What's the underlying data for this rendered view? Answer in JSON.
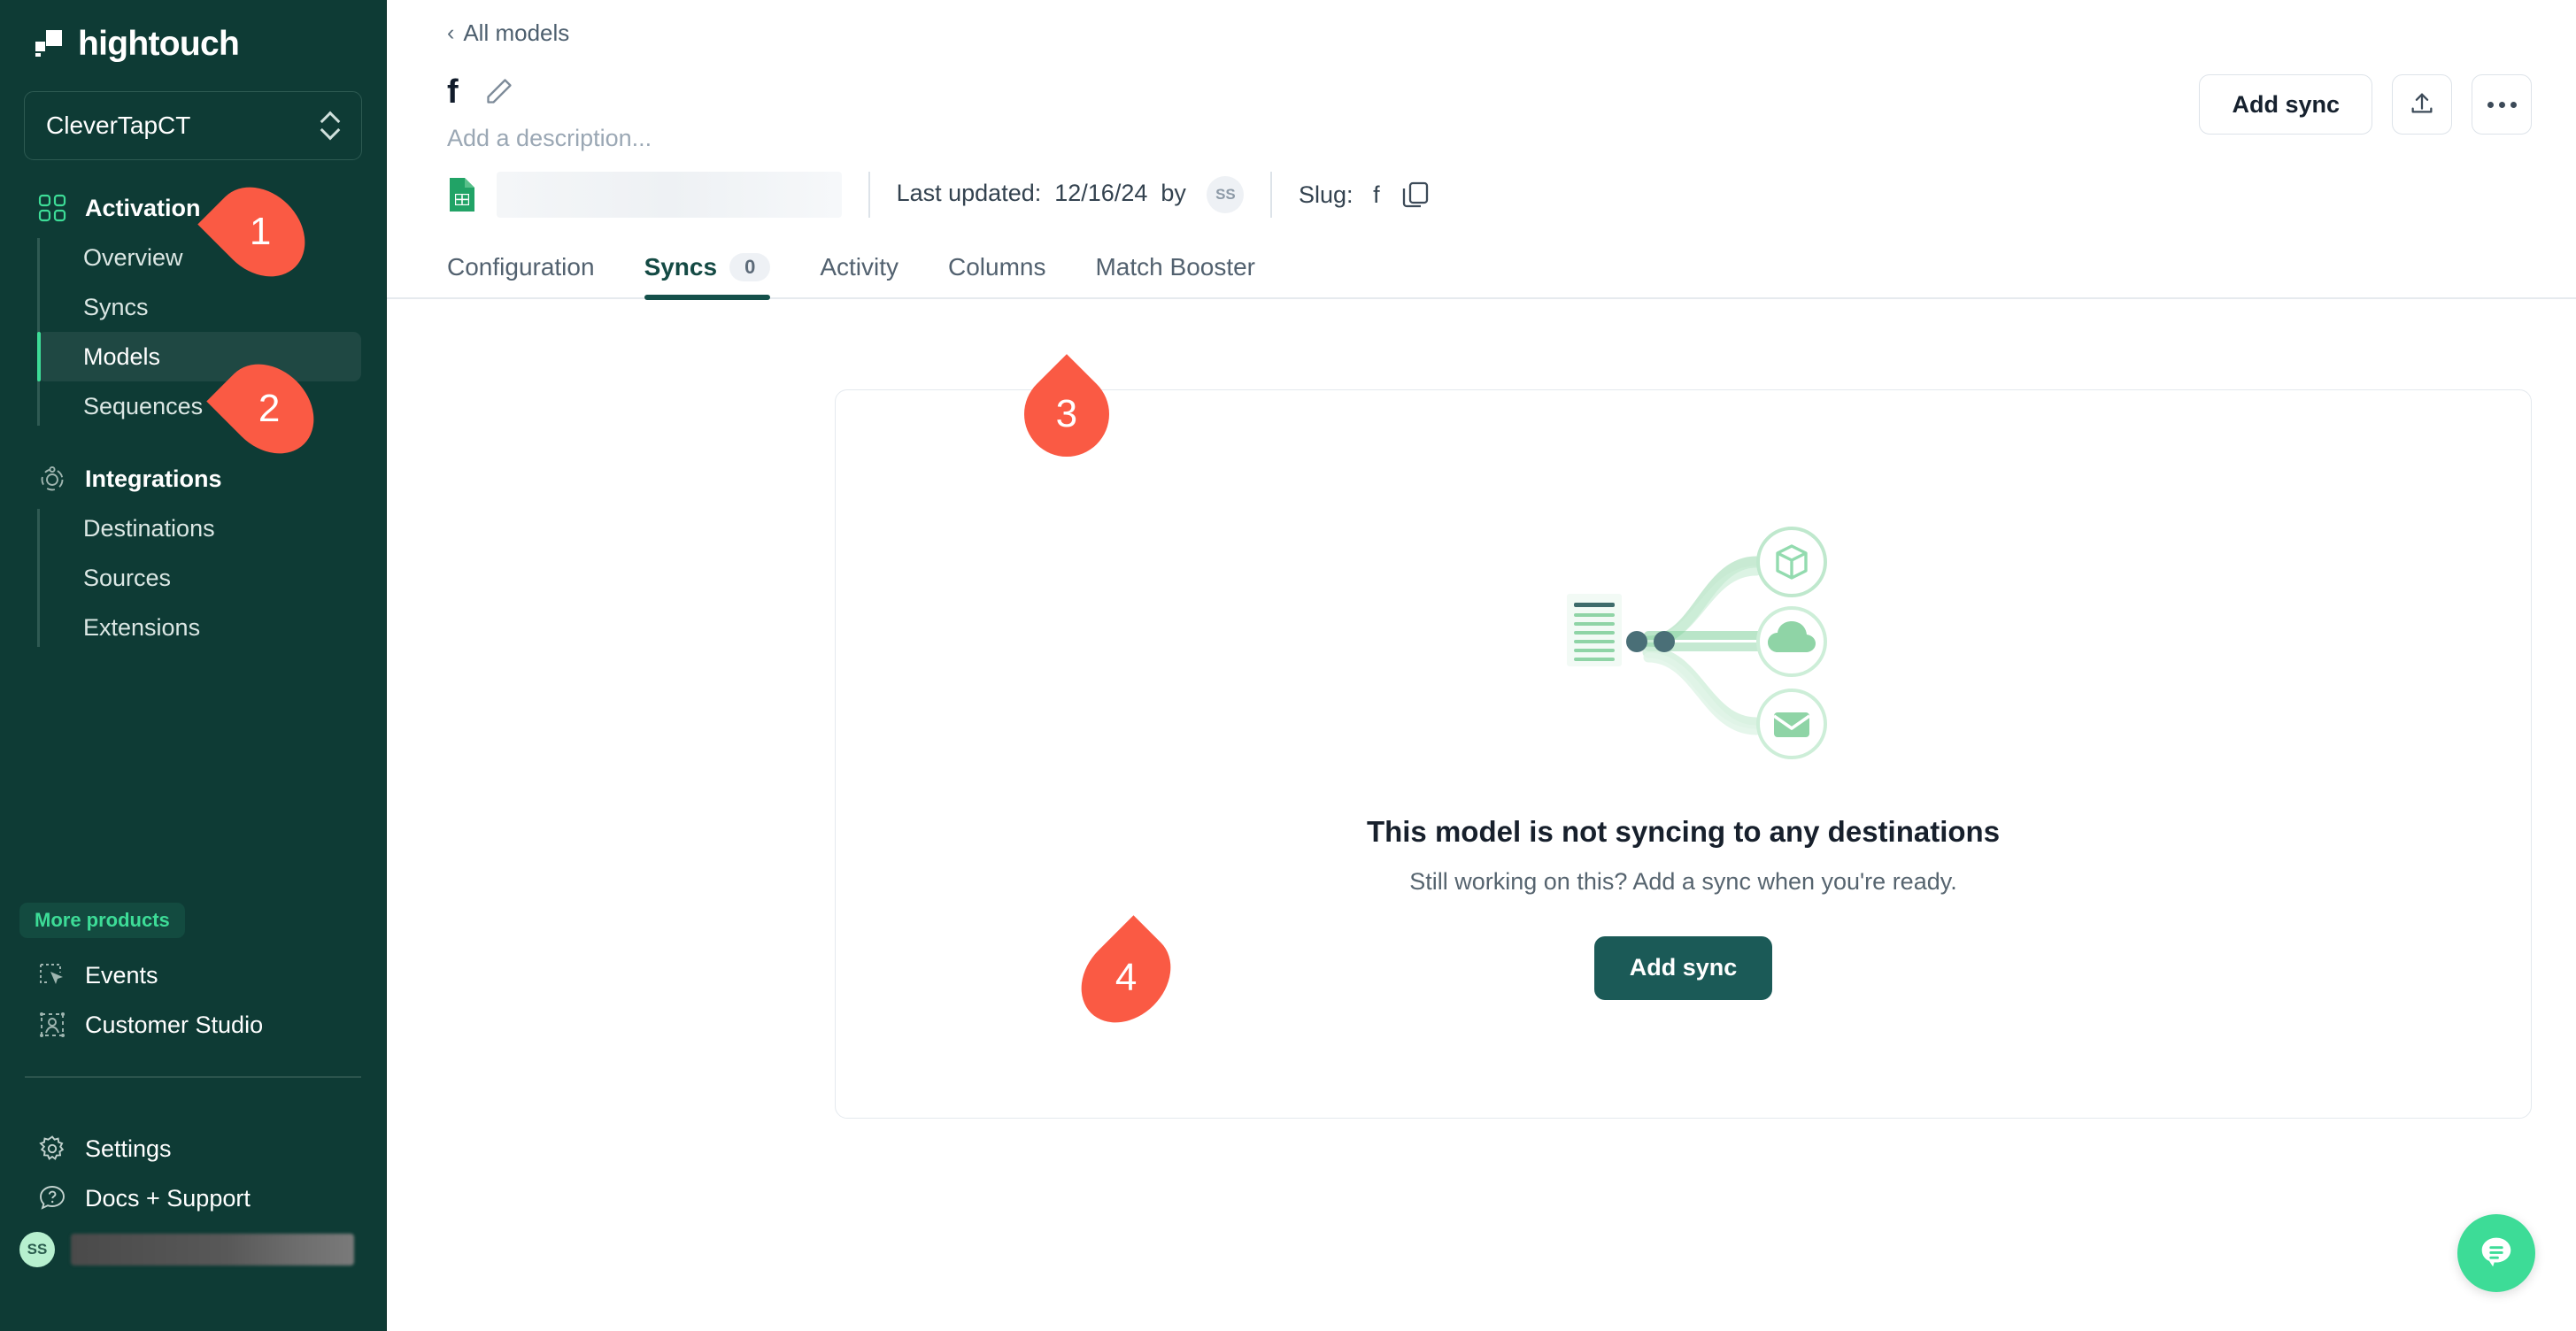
{
  "brand": {
    "name": "hightouch",
    "logo_icon": "hightouch-logo-icon",
    "colors": {
      "sidebar_bg": "#0e3b35",
      "accent_green": "#3ddc97",
      "primary_button": "#1b5a57",
      "marker_red": "#fa5a44",
      "active_tab": "#14504a"
    }
  },
  "sidebar": {
    "workspace": {
      "name": "CleverTapCT",
      "chevron_icon": "chevron-up-down-icon"
    },
    "sections": [
      {
        "label": "Activation",
        "icon": "grid-squares-icon",
        "items": [
          {
            "label": "Overview",
            "active": false
          },
          {
            "label": "Syncs",
            "active": false
          },
          {
            "label": "Models",
            "active": true
          },
          {
            "label": "Sequences",
            "active": false
          }
        ]
      },
      {
        "label": "Integrations",
        "icon": "orbit-icon",
        "items": [
          {
            "label": "Destinations",
            "active": false
          },
          {
            "label": "Sources",
            "active": false
          },
          {
            "label": "Extensions",
            "active": false
          }
        ]
      }
    ],
    "more_products_label": "More products",
    "more_products": [
      {
        "label": "Events",
        "icon": "events-cursor-icon"
      },
      {
        "label": "Customer Studio",
        "icon": "customer-studio-icon"
      }
    ],
    "footer": [
      {
        "label": "Settings",
        "icon": "gear-icon"
      },
      {
        "label": "Docs + Support",
        "icon": "question-bubble-icon"
      }
    ],
    "user": {
      "initials": "SS",
      "name_redacted": true
    }
  },
  "main": {
    "breadcrumb": {
      "label": "All models",
      "chevron_icon": "chevron-left-icon"
    },
    "title": "f",
    "edit_icon": "pencil-icon",
    "description_placeholder": "Add a description...",
    "source": {
      "icon": "google-sheets-icon",
      "name_redacted": true
    },
    "last_updated_label": "Last updated:",
    "last_updated_date": "12/16/24",
    "by_label": "by",
    "updated_by_initials": "SS",
    "slug_label": "Slug:",
    "slug_value": "f",
    "copy_icon": "copy-icon",
    "actions": {
      "add_sync_label": "Add sync",
      "upload_icon": "upload-icon",
      "more_icon": "ellipsis-icon"
    },
    "tabs": [
      {
        "label": "Configuration",
        "badge": null,
        "active": false
      },
      {
        "label": "Syncs",
        "badge": "0",
        "active": true
      },
      {
        "label": "Activity",
        "badge": null,
        "active": false
      },
      {
        "label": "Columns",
        "badge": null,
        "active": false
      },
      {
        "label": "Match Booster",
        "badge": null,
        "active": false
      }
    ],
    "empty_state": {
      "illustration_icon": "sync-flow-illustration",
      "title": "This model is not syncing to any destinations",
      "subtitle": "Still working on this? Add a sync when you're ready.",
      "button_label": "Add sync"
    },
    "chat_icon": "chat-bubble-icon"
  },
  "annotations": [
    {
      "number": "1",
      "target": "Activation",
      "direction": "left"
    },
    {
      "number": "2",
      "target": "Models",
      "direction": "left"
    },
    {
      "number": "3",
      "target": "Syncs tab",
      "direction": "up"
    },
    {
      "number": "4",
      "target": "Add sync button",
      "direction": "right"
    }
  ]
}
